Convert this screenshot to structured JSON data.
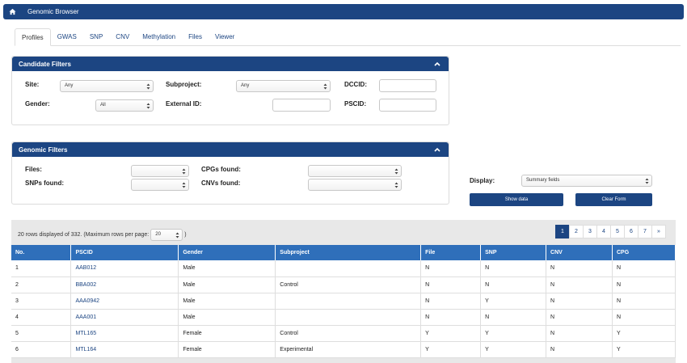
{
  "app": {
    "title": "Genomic Browser"
  },
  "tabs": [
    "Profiles",
    "GWAS",
    "SNP",
    "CNV",
    "Methylation",
    "Files",
    "Viewer"
  ],
  "candidate_filters": {
    "title": "Candidate Filters",
    "site_label": "Site:",
    "site_value": "Any",
    "subproject_label": "Subproject:",
    "subproject_value": "Any",
    "dccid_label": "DCCID:",
    "dccid_value": "",
    "gender_label": "Gender:",
    "gender_value": "All",
    "external_id_label": "External ID:",
    "external_id_value": "",
    "pscid_label": "PSCID:",
    "pscid_value": ""
  },
  "genomic_filters": {
    "title": "Genomic Filters",
    "files_label": "Files:",
    "files_value": "",
    "cpgs_label": "CPGs found:",
    "cpgs_value": "",
    "snps_label": "SNPs found:",
    "snps_value": "",
    "cnvs_label": "CNVs found:",
    "cnvs_value": ""
  },
  "display": {
    "label": "Display:",
    "value": "Summary fields",
    "show_data": "Show data",
    "clear_form": "Clear Form"
  },
  "results": {
    "info_prefix": "20 rows displayed of 332. (Maximum rows per page:",
    "info_suffix": ")",
    "per_page": "20",
    "pages": [
      "1",
      "2",
      "3",
      "4",
      "5",
      "6",
      "7",
      "»"
    ],
    "active_page": 0,
    "columns": [
      "No.",
      "PSCID",
      "Gender",
      "Subproject",
      "File",
      "SNP",
      "CNV",
      "CPG"
    ],
    "rows": [
      [
        "1",
        "AAB012",
        "Male",
        "",
        "N",
        "N",
        "N",
        "N"
      ],
      [
        "2",
        "BBA002",
        "Male",
        "Control",
        "N",
        "N",
        "N",
        "N"
      ],
      [
        "3",
        "AAA0942",
        "Male",
        "",
        "N",
        "Y",
        "N",
        "N"
      ],
      [
        "4",
        "AAA001",
        "Male",
        "",
        "N",
        "N",
        "N",
        "N"
      ],
      [
        "5",
        "MTL165",
        "Female",
        "Control",
        "Y",
        "Y",
        "N",
        "Y"
      ],
      [
        "6",
        "MTL164",
        "Female",
        "Experimental",
        "Y",
        "Y",
        "N",
        "Y"
      ]
    ]
  }
}
